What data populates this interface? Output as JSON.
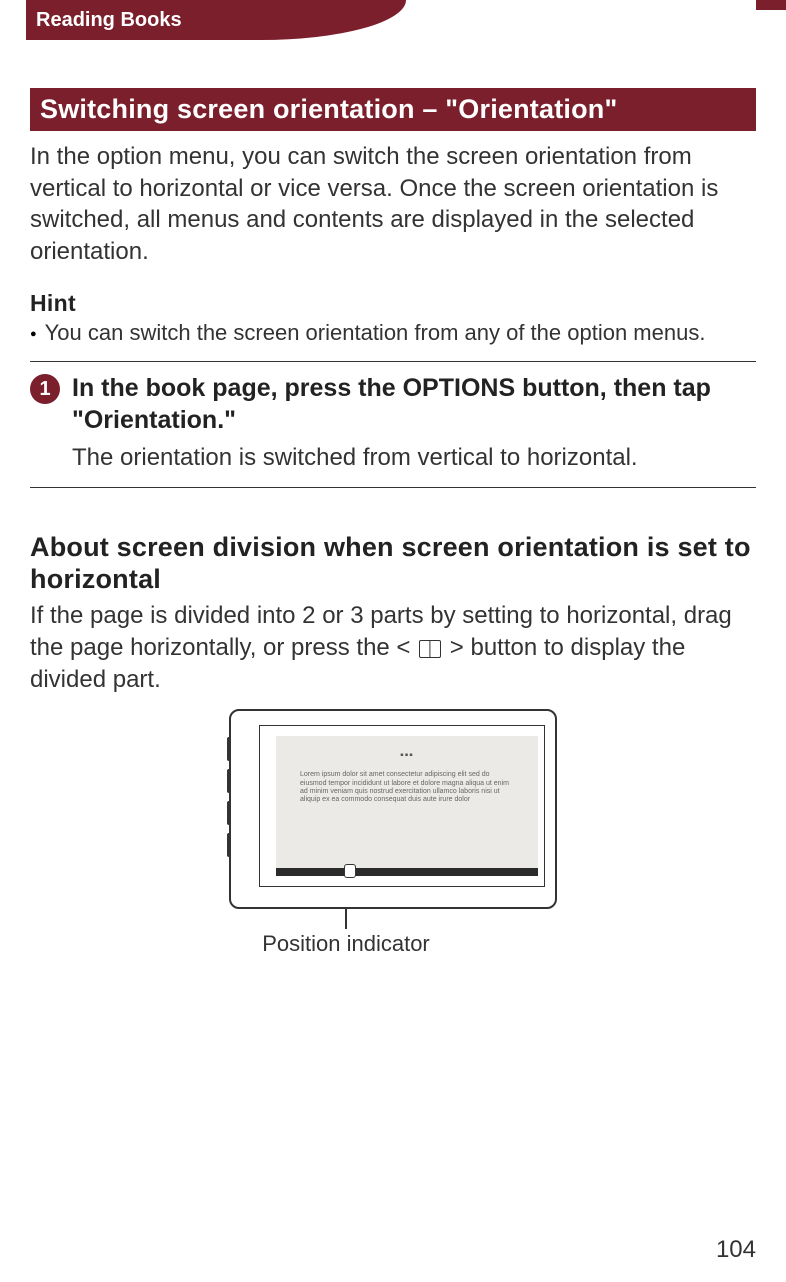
{
  "header": {
    "breadcrumb": "Reading Books"
  },
  "title": "Switching screen orientation – \"Orientation\"",
  "intro": "In the option menu, you can switch the screen orientation from vertical to horizontal or vice versa. Once the screen orientation is switched, all menus and contents are displayed in the selected orientation.",
  "hint": {
    "label": "Hint",
    "body": "You can switch the screen orientation from any of the option menus."
  },
  "step1": {
    "num": "1",
    "title": "In the book page, press the OPTIONS button, then tap \"Orientation.\"",
    "sub": "The orientation is switched from vertical to horizontal."
  },
  "section2": {
    "title": "About screen division when screen orientation is set to horizontal",
    "body_pre": "If the page is divided into 2 or 3 parts by setting to horizontal, drag the page horizontally, or press the < ",
    "body_post": " > button to display the divided part."
  },
  "figure": {
    "caption": "Position indicator"
  },
  "page_number": "104"
}
